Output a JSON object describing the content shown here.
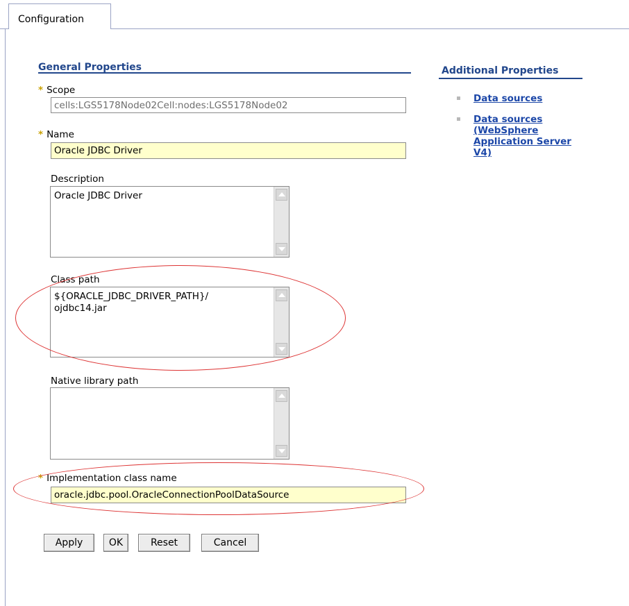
{
  "tabs": [
    {
      "label": "Configuration"
    }
  ],
  "general": {
    "title": "General Properties"
  },
  "scope": {
    "label": "Scope",
    "value": "cells:LGS5178Node02Cell:nodes:LGS5178Node02"
  },
  "name": {
    "label": "Name",
    "value": "Oracle JDBC Driver"
  },
  "description": {
    "label": "Description",
    "value": "Oracle JDBC Driver"
  },
  "class_path": {
    "label": "Class path",
    "value": "${ORACLE_JDBC_DRIVER_PATH}/\nojdbc14.jar"
  },
  "native_path": {
    "label": "Native library path",
    "value": ""
  },
  "impl_class": {
    "label": "Implementation class name",
    "value": "oracle.jdbc.pool.OracleConnectionPoolDataSource"
  },
  "required_marker": "*",
  "buttons": {
    "apply": "Apply",
    "ok": "OK",
    "reset": "Reset",
    "cancel": "Cancel"
  },
  "additional": {
    "title": "Additional Properties",
    "links": [
      {
        "label": "Data sources"
      },
      {
        "label": "Data sources\n(WebSphere\nApplication Server\nV4)"
      }
    ]
  },
  "colors": {
    "section_title": "#22478c",
    "link": "#1c47a8",
    "required_field_bg": "#ffffcc",
    "annotation": "#dd3333"
  }
}
